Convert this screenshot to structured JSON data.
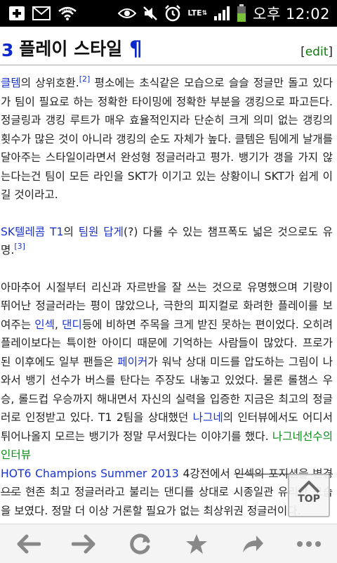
{
  "status_bar": {
    "clock": "오후 12:02",
    "network": "LTE",
    "icons": [
      "add-notification-icon",
      "mail-icon",
      "wifi-new-icon",
      "eye-icon",
      "mute-icon",
      "alarm-icon",
      "lte-icon",
      "signal-icon",
      "battery-icon"
    ]
  },
  "section": {
    "number": "3",
    "title": "플레이 스타일",
    "pilcrow": "¶",
    "edit_open": "[",
    "edit_label": "edit",
    "edit_close": "]"
  },
  "paragraph1": {
    "link_clem": "클템",
    "t1": "의 상위호환.",
    "ref2": "[2]",
    "t2": " 평소에는 초식같은 모습으로 슬슬 정글만 돌고 있다가 팀이 필요로 하는 정확한 타이밍에 정확한 부분을 갱킹으로 파고든다. 정글링과 갱킹 루트가 매우 효율적인지라 단순히 크게 의미 없는 갱킹의 횟수가 많은 것이 아니라 갱킹의 순도 자체가 높다. 클템은 팀에게 날개를 달아주는 스타일이라면서 완성형 정글러라고 평가. 뱅기가 갱을 가지 않는다는건 팀이 모든 라인을 SKT가 이기고 있는 상황이니 SKT가 쉽게 이길 것이라고."
  },
  "paragraph2": {
    "link_skt": "SK텔레콤 T1",
    "t1": "의 ",
    "link_member": "팀원",
    "t2": " ",
    "link_dagge": "답게",
    "t3": "(?) 다룰 수 있는 챔프폭도 넓은 것으로도 유명.",
    "ref3": "[3]"
  },
  "paragraph3": {
    "t1": "아마추어 시절부터 리신과 자르반을 잘 쓰는 것으로 유명했으며 기량이 뛰어난 정글러라는 평이 많았으나, 극한의 피지컬로 화려한 플레이를 보여주는 ",
    "link_insec": "인섹",
    "t2": ", ",
    "link_dandy": "댄디",
    "t3": "등에 비하면 주목을 크게 받진 못하는 편이었다. 오히려 플레이보다는 특이한 아이디 때문에 기억하는 사람들이 많았다. 프로가 된 이후에도 일부 팬들은 ",
    "link_faker": "페이커",
    "t4": "가 워낙 상대 미드를 압도하는 그림이 나와서 뱅기 선수가 버스를 탄다는 주장도 내놓고 있었다. 물론 롤챔스 우승, 롤드컵 우승까지 해내면서 자신의 실력을 입증한 지금은 최고의 정글러로 인정받고 있다. T1 2팀을 상대했던 ",
    "link_nagne": "나그네",
    "t5": "의 인터뷰에서도 어디서 튀어나올지 모르는 뱅기가 정말 무서웠다는 이야기를 했다. ",
    "link_interview": "나그네선수의 인터뷰",
    "link_hot6": "HOT6 Champions Summer 2013",
    "t6": " 4강전에서 ",
    "strike": "인섹의 포지션을 변경으로",
    "t7": " 현존 최고 정글러라고 불리는 댄디를 상대로 시종일관 유리한 모습을 보였다. 정말 더 이상 거론할 필요가 없는 최상위권 정글러이다."
  },
  "top_button": {
    "label": "TOP"
  },
  "toolbar": {
    "icons": [
      "back-icon",
      "forward-icon",
      "refresh-icon",
      "bookmark-star-icon",
      "share-icon",
      "more-icon"
    ]
  }
}
